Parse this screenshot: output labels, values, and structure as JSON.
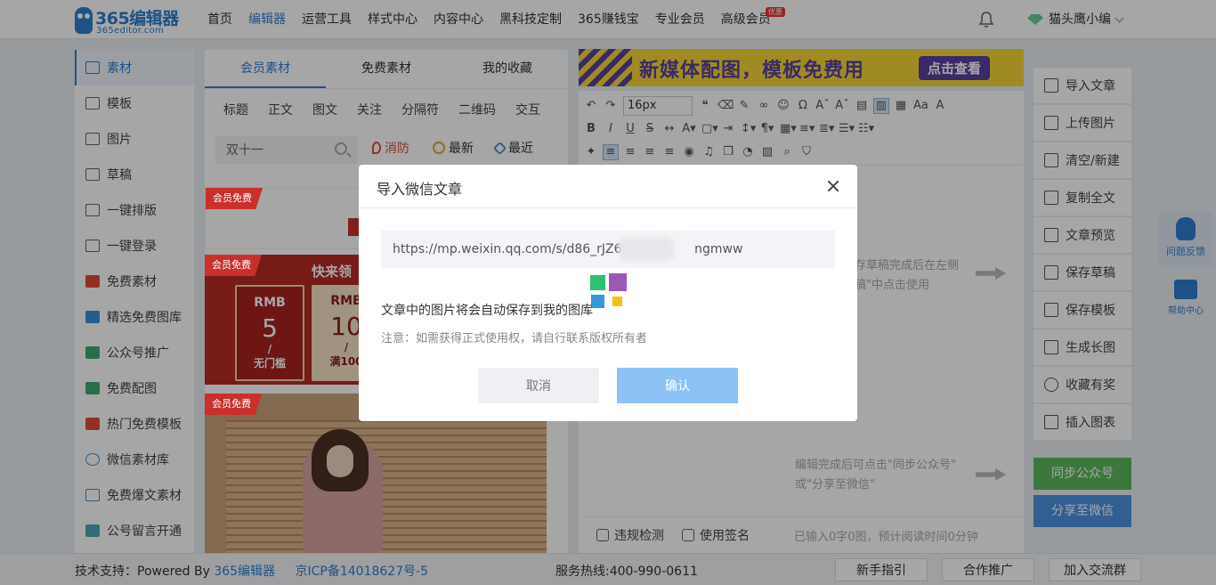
{
  "topnav": {
    "brand": "365编辑器",
    "domain": "365editor.com",
    "items": [
      "首页",
      "编辑器",
      "运营工具",
      "样式中心",
      "内容中心",
      "黑科技定制",
      "365赚钱宝",
      "专业会员",
      "高级会员"
    ],
    "badge": "优惠",
    "user_name": "猫头鹰小编",
    "accent": "#2f7fd0"
  },
  "sidebar": {
    "items": [
      "素材",
      "模板",
      "图片",
      "草稿",
      "一键排版",
      "一键登录",
      "免费素材",
      "精选免费图库",
      "公众号推广",
      "免费配图",
      "热门免费模板",
      "微信素材库",
      "免费爆文素材",
      "公号留言开通"
    ]
  },
  "material": {
    "tabs": [
      "会员素材",
      "免费素材",
      "我的收藏"
    ],
    "categories": [
      "标题",
      "正文",
      "图文",
      "关注",
      "分隔符",
      "二维码",
      "交互"
    ],
    "search_value": "双十一",
    "filters": [
      "消防",
      "最新",
      "最近"
    ],
    "card_tag": "会员免费",
    "card2_head": "快来领",
    "coupon_a": {
      "rmb": "RMB",
      "num": "5",
      "slash": "/",
      "sub": "无门槛"
    },
    "coupon_b": {
      "rmb": "RMB",
      "num": "10",
      "slash": "/",
      "sub": "满100"
    }
  },
  "editor": {
    "banner_text": "新媒体配图，模板免费用",
    "banner_cta": "点击查看",
    "font_size": "16px",
    "hint_1a": "存草稿完成后在左侧",
    "hint_1b": "稿\"中点击使用",
    "hint_2a": "编辑完成后可点击\"同步公众号\"",
    "hint_2b": "或\"分享至微信\"",
    "footer_check": "违规检测",
    "footer_sign": "使用签名",
    "footer_stat": "已输入0字0图，预计阅读时间0分钟"
  },
  "actions": {
    "items": [
      "导入文章",
      "上传图片",
      "清空/新建",
      "复制全文",
      "文章预览",
      "保存草稿",
      "保存模板",
      "生成长图",
      "收藏有奖",
      "插入图表"
    ],
    "sync": "同步公众号",
    "share": "分享至微信"
  },
  "float": {
    "feedback": "问题反馈",
    "help": "帮助中心"
  },
  "footer": {
    "support": "技术支持：Powered By ",
    "support_link": "365编辑器",
    "icp": "京ICP备14018627号-5",
    "hotline": "服务热线:400-990-0611",
    "buttons": [
      "新手指引",
      "合作推广",
      "加入交流群"
    ]
  },
  "modal": {
    "title": "导入微信文章",
    "url_value": "https://mp.weixin.qq.com/s/d86_rJZ6vQu            ngmww",
    "info": "文章中的图片将会自动保存到我的图库",
    "note": "注意：如需获得正式使用权，请自行联系版权所有者",
    "cancel": "取消",
    "confirm": "确认"
  }
}
